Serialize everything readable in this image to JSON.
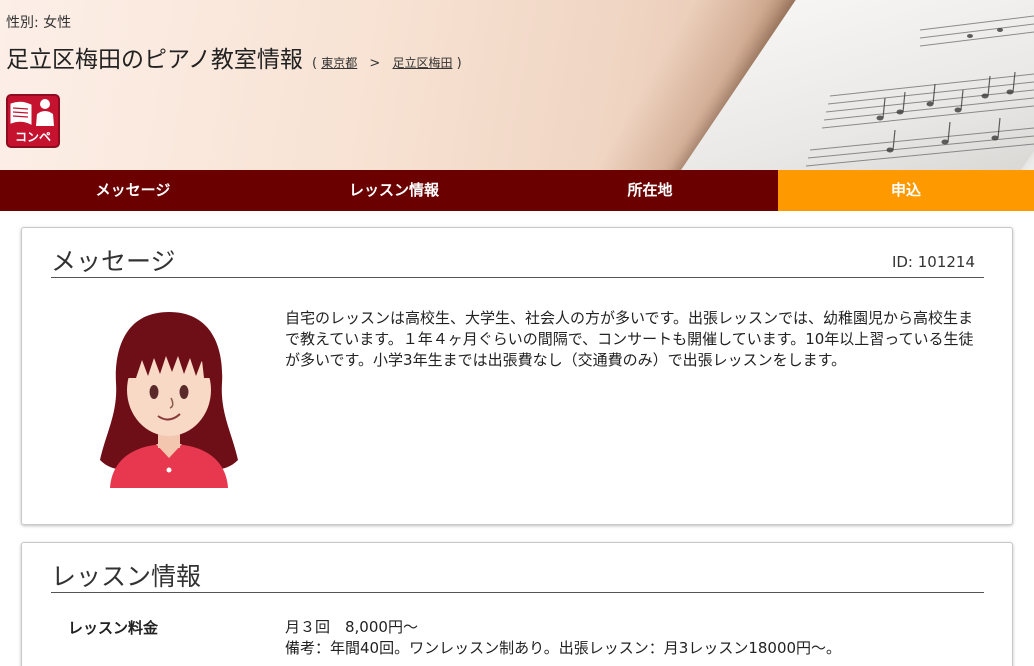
{
  "header": {
    "gender_text": "性別: 女性",
    "title": "足立区梅田のピアノ教室情報",
    "breadcrumb": {
      "open": "(",
      "prefecture": "東京都",
      "separator": ">",
      "area": "足立区梅田",
      "close": ")"
    },
    "badge_label": "コンペ"
  },
  "nav": {
    "tabs": [
      {
        "label": "メッセージ"
      },
      {
        "label": "レッスン情報"
      },
      {
        "label": "所在地"
      },
      {
        "label": "申込"
      }
    ],
    "active_index": 3
  },
  "message": {
    "heading": "メッセージ",
    "id_text": "ID: 101214",
    "body": "自宅のレッスンは高校生、大学生、社会人の方が多いです。出張レッスンでは、幼稚園児から高校生まで教えています。１年４ヶ月ぐらいの間隔で、コンサートも開催しています。10年以上習っている生徒が多いです。小学3年生までは出張費なし（交通費のみ）で出張レッスンをします。"
  },
  "lesson": {
    "heading": "レッスン情報",
    "fee_label": "レッスン料金",
    "fee_line1": "月３回　8,000円～",
    "fee_line2": "備考：年間40回。ワンレッスン制あり。出張レッスン：月3レッスン18000円〜。"
  },
  "colors": {
    "nav_bg": "#6b0000",
    "nav_active": "#ff9900",
    "badge": "#c4122f"
  }
}
